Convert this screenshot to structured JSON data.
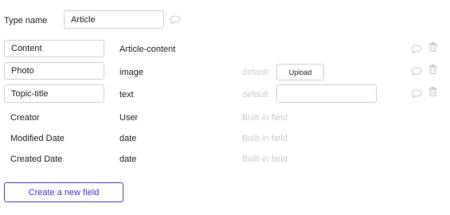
{
  "type_name": {
    "label": "Type name",
    "value": "Article"
  },
  "fields": [
    {
      "name": "Content",
      "type": "Article-content",
      "default_label": "",
      "control": "",
      "editable": true
    },
    {
      "name": "Photo",
      "type": "image",
      "default_label": "default",
      "control": "Upload",
      "editable": true
    },
    {
      "name": "Topic-title",
      "type": "text",
      "default_label": "default",
      "control": "",
      "editable": true
    },
    {
      "name": "Creator",
      "type": "User",
      "default_label": "Built-in field",
      "editable": false
    },
    {
      "name": "Modified Date",
      "type": "date",
      "default_label": "Built-in field",
      "editable": false
    },
    {
      "name": "Created Date",
      "type": "date",
      "default_label": "Built-in field",
      "editable": false
    }
  ],
  "actions": {
    "create_label": "Create a new field"
  },
  "icons": {
    "comment": "comment-bubble-icon",
    "delete": "trash-icon"
  },
  "colors": {
    "accent": "#4b3fd0",
    "muted_text": "#c9c9c9",
    "border": "#cfcfcf"
  }
}
